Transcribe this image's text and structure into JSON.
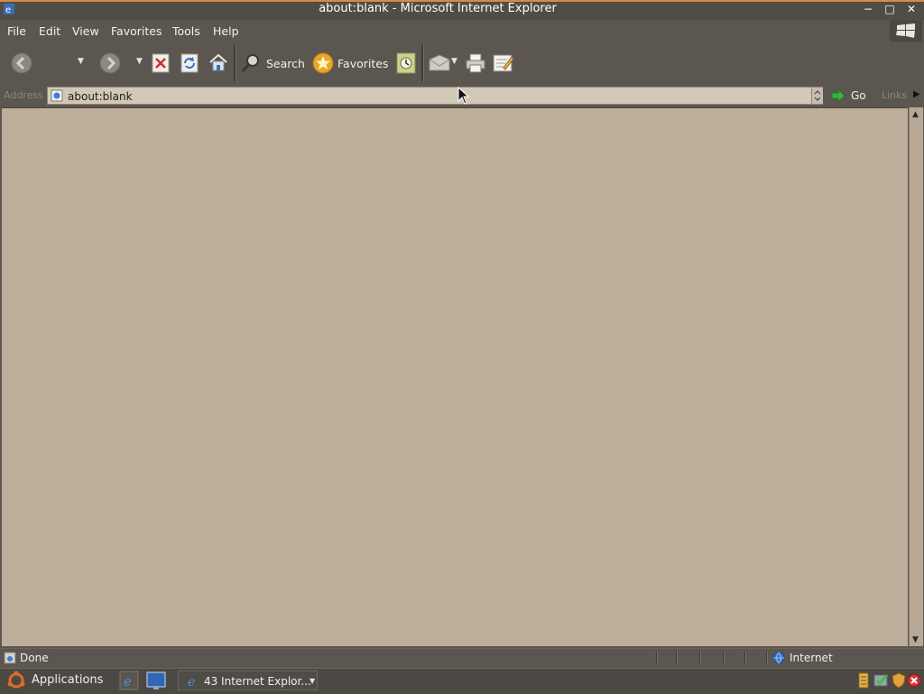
{
  "window": {
    "title": "about:blank - Microsoft Internet Explorer",
    "minimize": "−",
    "maximize": "□",
    "close": "✕"
  },
  "menu": {
    "items": [
      "File",
      "Edit",
      "View",
      "Favorites",
      "Tools",
      "Help"
    ]
  },
  "toolbar": {
    "search_label": "Search",
    "favorites_label": "Favorites",
    "icons": [
      "back-icon",
      "forward-icon",
      "stop-icon",
      "refresh-icon",
      "home-icon",
      "search-icon",
      "favorites-icon",
      "history-icon",
      "mail-icon",
      "print-icon",
      "edit-icon"
    ]
  },
  "address": {
    "label": "Address",
    "url": "about:blank",
    "go_label": "Go",
    "links_label": "Links"
  },
  "status": {
    "text": "Done",
    "zone": "Internet"
  },
  "taskbar": {
    "applications_label": "Applications",
    "task_label": "43 Internet Explor..."
  },
  "colors": {
    "accent": "#d88a46",
    "content_bg": "#bfae9a",
    "chrome": "#5b5650"
  }
}
